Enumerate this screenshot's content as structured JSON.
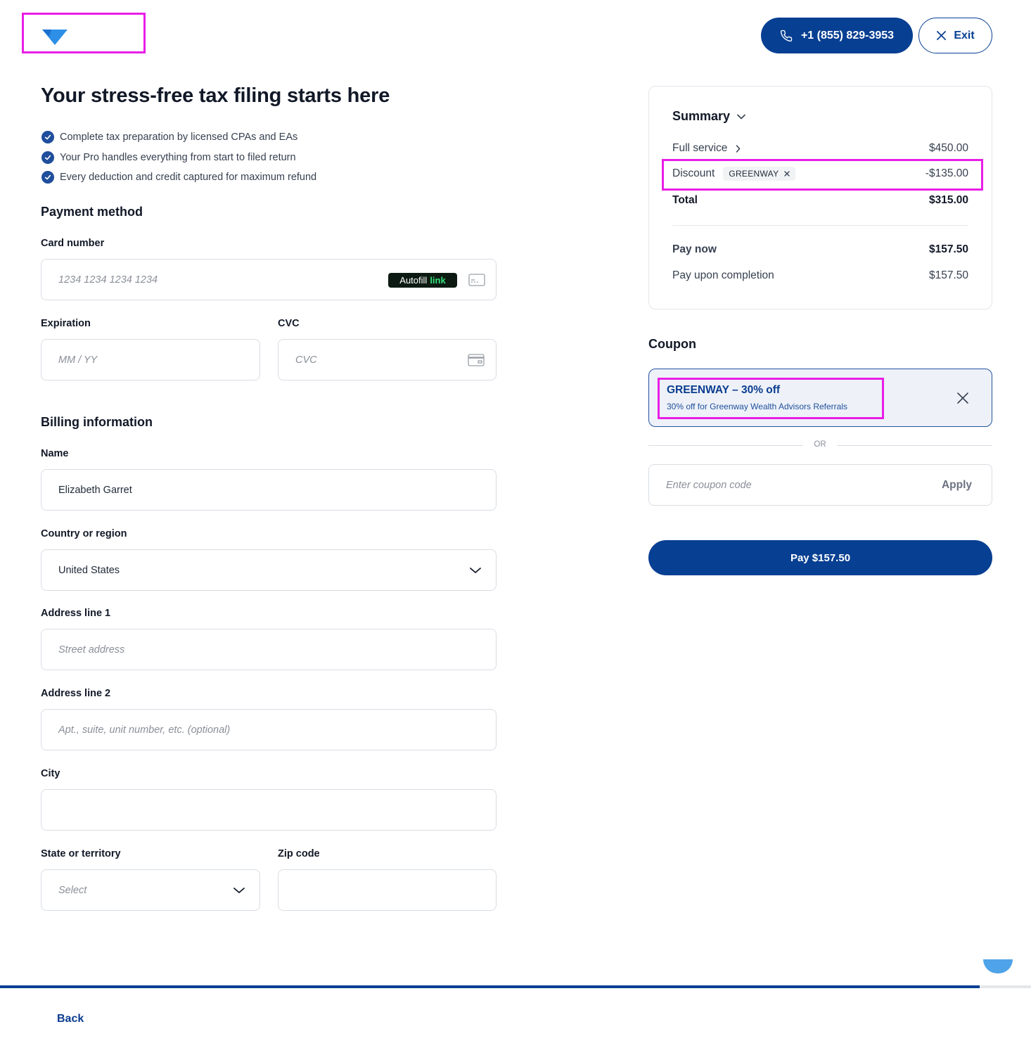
{
  "header": {
    "phone_label": "+1 (855) 829-3953",
    "exit_label": "Exit"
  },
  "intro": {
    "headline": "Your stress-free tax filing starts here",
    "bullets": [
      "Complete tax preparation by licensed CPAs and EAs",
      "Your Pro handles everything from start to filed return",
      "Every deduction and credit captured for maximum refund"
    ]
  },
  "payment": {
    "title": "Payment method",
    "card_label": "Card number",
    "card_placeholder": "1234 1234 1234 1234",
    "autofill_text": "Autofill",
    "autofill_link": "link",
    "expiration_label": "Expiration",
    "expiration_placeholder": "MM / YY",
    "cvc_label": "CVC",
    "cvc_placeholder": "CVC"
  },
  "billing": {
    "title": "Billing information",
    "name_label": "Name",
    "name_value": "Elizabeth Garret",
    "country_label": "Country or region",
    "country_value": "United States",
    "address1_label": "Address line 1",
    "address1_placeholder": "Street address",
    "address2_label": "Address line 2",
    "address2_placeholder": "Apt., suite, unit number, etc. (optional)",
    "city_label": "City",
    "city_value": "",
    "state_label": "State or territory",
    "state_placeholder": "Select",
    "zip_label": "Zip code",
    "zip_value": ""
  },
  "summary": {
    "title": "Summary",
    "full_service_label": "Full service",
    "full_service_value": "$450.00",
    "discount_label": "Discount",
    "discount_code": "GREENWAY",
    "discount_value": "-$135.00",
    "total_label": "Total",
    "total_value": "$315.00",
    "pay_now_label": "Pay now",
    "pay_now_value": "$157.50",
    "pay_later_label": "Pay upon completion",
    "pay_later_value": "$157.50"
  },
  "coupon": {
    "title": "Coupon",
    "applied_title": "GREENWAY – 30% off",
    "applied_desc": "30% off for Greenway Wealth Advisors Referrals",
    "or_text": "OR",
    "input_placeholder": "Enter coupon code",
    "apply_label": "Apply"
  },
  "pay_button_label": "Pay $157.50",
  "footer": {
    "back_label": "Back",
    "progress_fraction": 0.95
  },
  "colors": {
    "primary": "#073f92",
    "highlight": "#e91ee6",
    "logo": "#2d8fe6",
    "coupon_bg": "#eef2f8",
    "autofill_bg": "#0c1a12",
    "autofill_link": "#35e07a"
  },
  "icons": {
    "phone": "phone-icon",
    "exit": "close-icon",
    "check": "check-circle-icon",
    "card": "card-icon",
    "chevron": "chevron-down-icon"
  }
}
